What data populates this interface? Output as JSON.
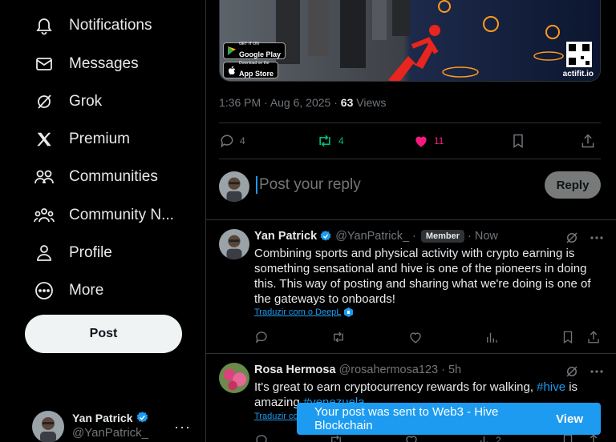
{
  "nav": {
    "items": [
      {
        "label": "Notifications",
        "icon": "bell-icon"
      },
      {
        "label": "Messages",
        "icon": "envelope-icon"
      },
      {
        "label": "Grok",
        "icon": "grok-icon"
      },
      {
        "label": "Premium",
        "icon": "x-logo-icon"
      },
      {
        "label": "Communities",
        "icon": "people-icon"
      },
      {
        "label": "Community N...",
        "icon": "community-notes-icon"
      },
      {
        "label": "Profile",
        "icon": "person-icon"
      },
      {
        "label": "More",
        "icon": "more-circle-icon"
      }
    ],
    "post_label": "Post"
  },
  "account": {
    "name": "Yan Patrick",
    "handle": "@YanPatrick_",
    "more": "···"
  },
  "media": {
    "google_play_small": "GET IT ON",
    "google_play": "Google Play",
    "app_store_small": "Download on the",
    "app_store": "App Store",
    "brand": "actifit.io"
  },
  "post_meta": {
    "time": "1:36 PM",
    "sep": " · ",
    "date": "Aug 6, 2025",
    "views_count": "63",
    "views_label": "Views"
  },
  "post_actions": {
    "replies": "4",
    "reposts": "4",
    "likes": "11"
  },
  "reply_box": {
    "placeholder": "Post your reply",
    "button": "Reply"
  },
  "replies": [
    {
      "name": "Yan Patrick",
      "handle": "@YanPatrick_",
      "dot": "·",
      "badge": "Member",
      "time": "Now",
      "text": "Combining sports and physical activity with crypto earning is something sensational and hive is one of the pioneers in doing this. This way of posting and sharing what we're doing is one of the gateways to onboards!",
      "translate": "Traduzir com o DeepL"
    },
    {
      "name": "Rosa Hermosa",
      "handle": "@rosahermosa123",
      "dot": "·",
      "time": "5h",
      "text_before": "It's great to earn cryptocurrency rewards for walking, ",
      "hashtag1": "#hive",
      "text_mid": " is amazing ",
      "hashtag2": "#venezuela",
      "translate": "Traduzir com o DeepL",
      "reply_count": "",
      "view_count": "2"
    }
  ],
  "toast": {
    "message": "Your post was sent to Web3 - Hive Blockchain",
    "action": "View"
  },
  "colors": {
    "accent": "#1d9bf0",
    "like": "#f91880",
    "repost": "#00ba7c",
    "muted": "#71767b",
    "border": "#2f3336"
  }
}
